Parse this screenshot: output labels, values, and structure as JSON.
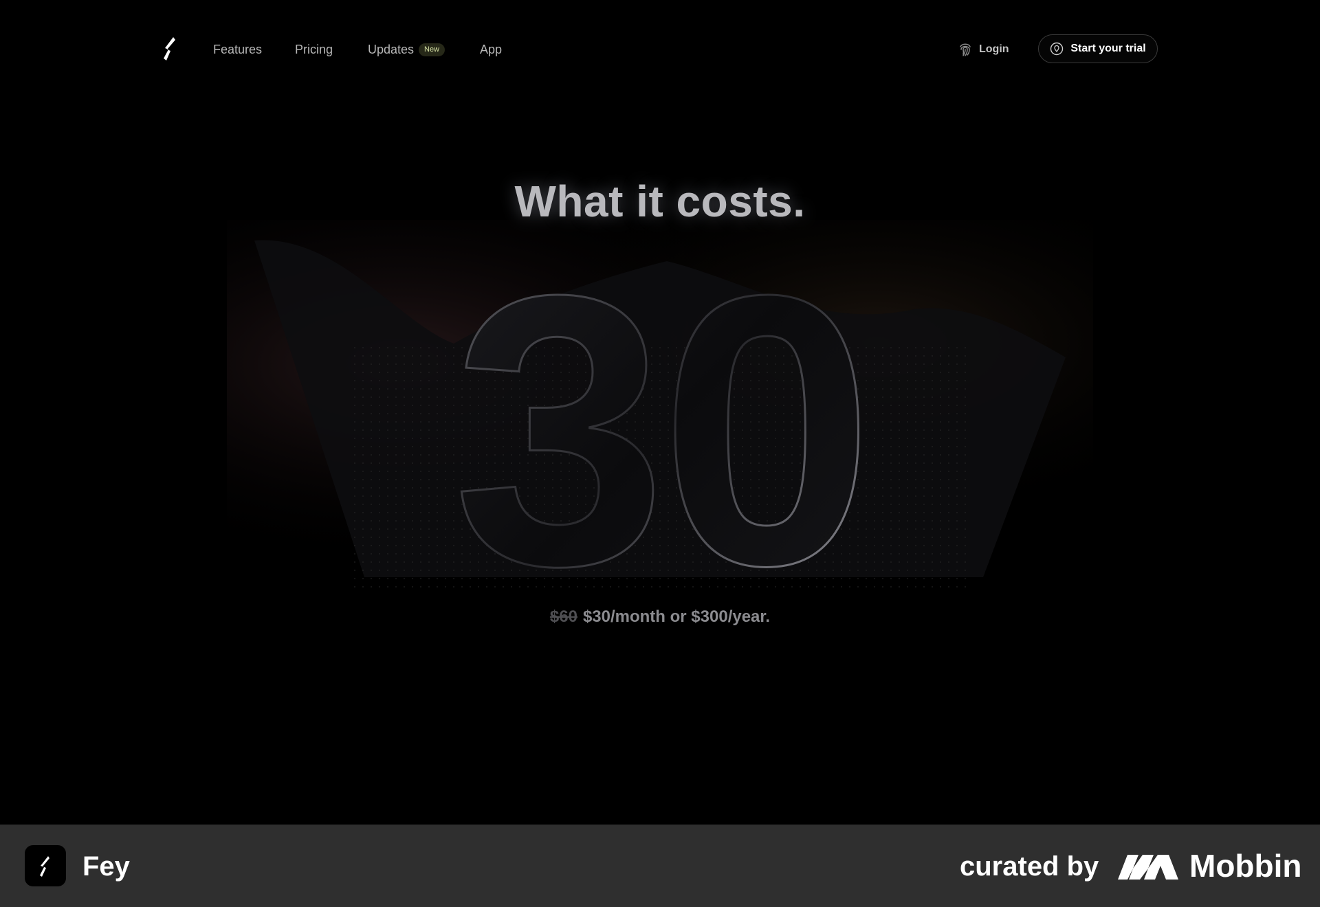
{
  "nav": {
    "links": [
      {
        "label": "Features"
      },
      {
        "label": "Pricing"
      },
      {
        "label": "Updates",
        "badge": "New"
      },
      {
        "label": "App"
      }
    ],
    "login_label": "Login",
    "trial_label": "Start your trial"
  },
  "hero": {
    "title": "What it costs.",
    "big_number": "30",
    "old_price": "$60",
    "price_text": "$30/month or $300/year."
  },
  "footer": {
    "app_name": "Fey",
    "curated_label": "curated by",
    "brand_name": "Mobbin"
  },
  "colors": {
    "background": "#000000",
    "footer_bar": "#2f2f2f",
    "badge_bg": "#262818",
    "badge_text": "#d7e2a6"
  }
}
